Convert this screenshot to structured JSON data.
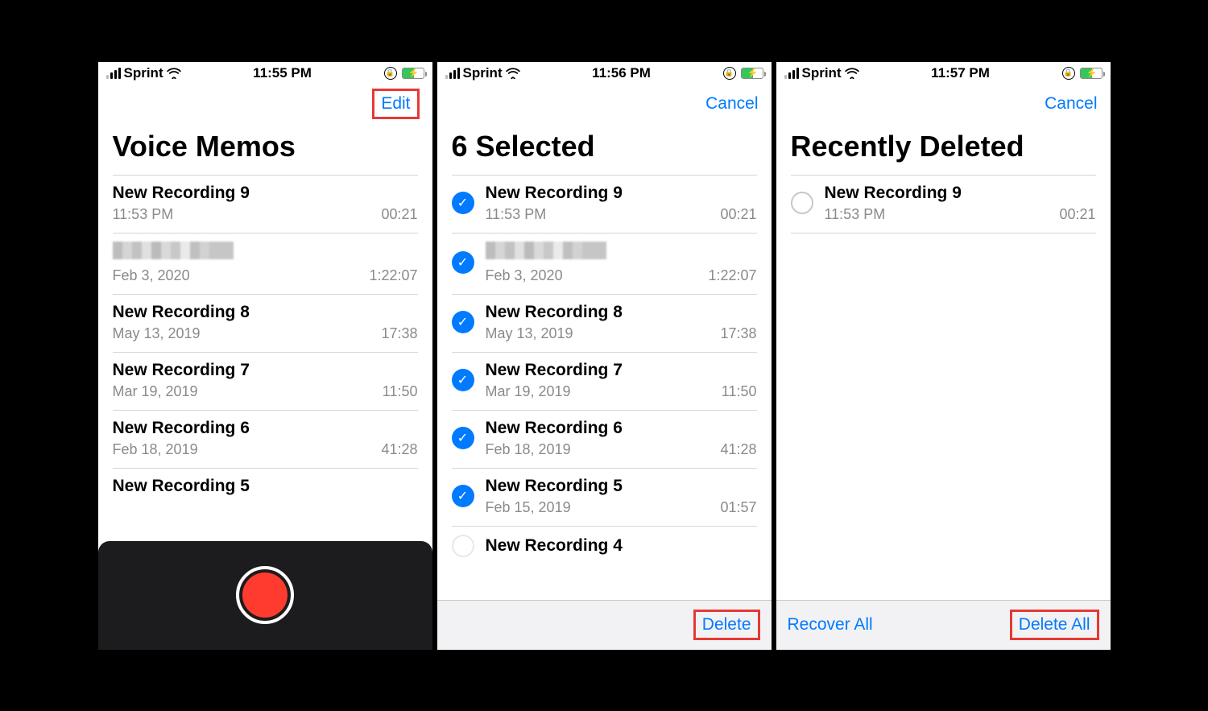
{
  "screen1": {
    "status": {
      "carrier": "Sprint",
      "time": "11:55 PM"
    },
    "nav": {
      "edit": "Edit"
    },
    "title": "Voice Memos",
    "items": [
      {
        "title": "New Recording 9",
        "date": "11:53 PM",
        "duration": "00:21",
        "pixelated": false
      },
      {
        "title": "",
        "date": "Feb 3, 2020",
        "duration": "1:22:07",
        "pixelated": true
      },
      {
        "title": "New Recording 8",
        "date": "May 13, 2019",
        "duration": "17:38",
        "pixelated": false
      },
      {
        "title": "New Recording 7",
        "date": "Mar 19, 2019",
        "duration": "11:50",
        "pixelated": false
      },
      {
        "title": "New Recording 6",
        "date": "Feb 18, 2019",
        "duration": "41:28",
        "pixelated": false
      }
    ],
    "partial": {
      "title": "New Recording 5"
    }
  },
  "screen2": {
    "status": {
      "carrier": "Sprint",
      "time": "11:56 PM"
    },
    "nav": {
      "cancel": "Cancel"
    },
    "title": "6 Selected",
    "items": [
      {
        "title": "New Recording 9",
        "date": "11:53 PM",
        "duration": "00:21",
        "pixelated": false,
        "checked": true
      },
      {
        "title": "",
        "date": "Feb 3, 2020",
        "duration": "1:22:07",
        "pixelated": true,
        "checked": true
      },
      {
        "title": "New Recording 8",
        "date": "May 13, 2019",
        "duration": "17:38",
        "pixelated": false,
        "checked": true
      },
      {
        "title": "New Recording 7",
        "date": "Mar 19, 2019",
        "duration": "11:50",
        "pixelated": false,
        "checked": true
      },
      {
        "title": "New Recording 6",
        "date": "Feb 18, 2019",
        "duration": "41:28",
        "pixelated": false,
        "checked": true
      },
      {
        "title": "New Recording 5",
        "date": "Feb 15, 2019",
        "duration": "01:57",
        "pixelated": false,
        "checked": true
      }
    ],
    "partial": {
      "title": "New Recording 4"
    },
    "bottom": {
      "delete": "Delete"
    }
  },
  "screen3": {
    "status": {
      "carrier": "Sprint",
      "time": "11:57 PM"
    },
    "nav": {
      "cancel": "Cancel"
    },
    "title": "Recently Deleted",
    "items": [
      {
        "title": "New Recording 9",
        "date": "11:53 PM",
        "duration": "00:21",
        "checked": false
      }
    ],
    "bottom": {
      "recover": "Recover All",
      "deleteAll": "Delete All"
    }
  }
}
